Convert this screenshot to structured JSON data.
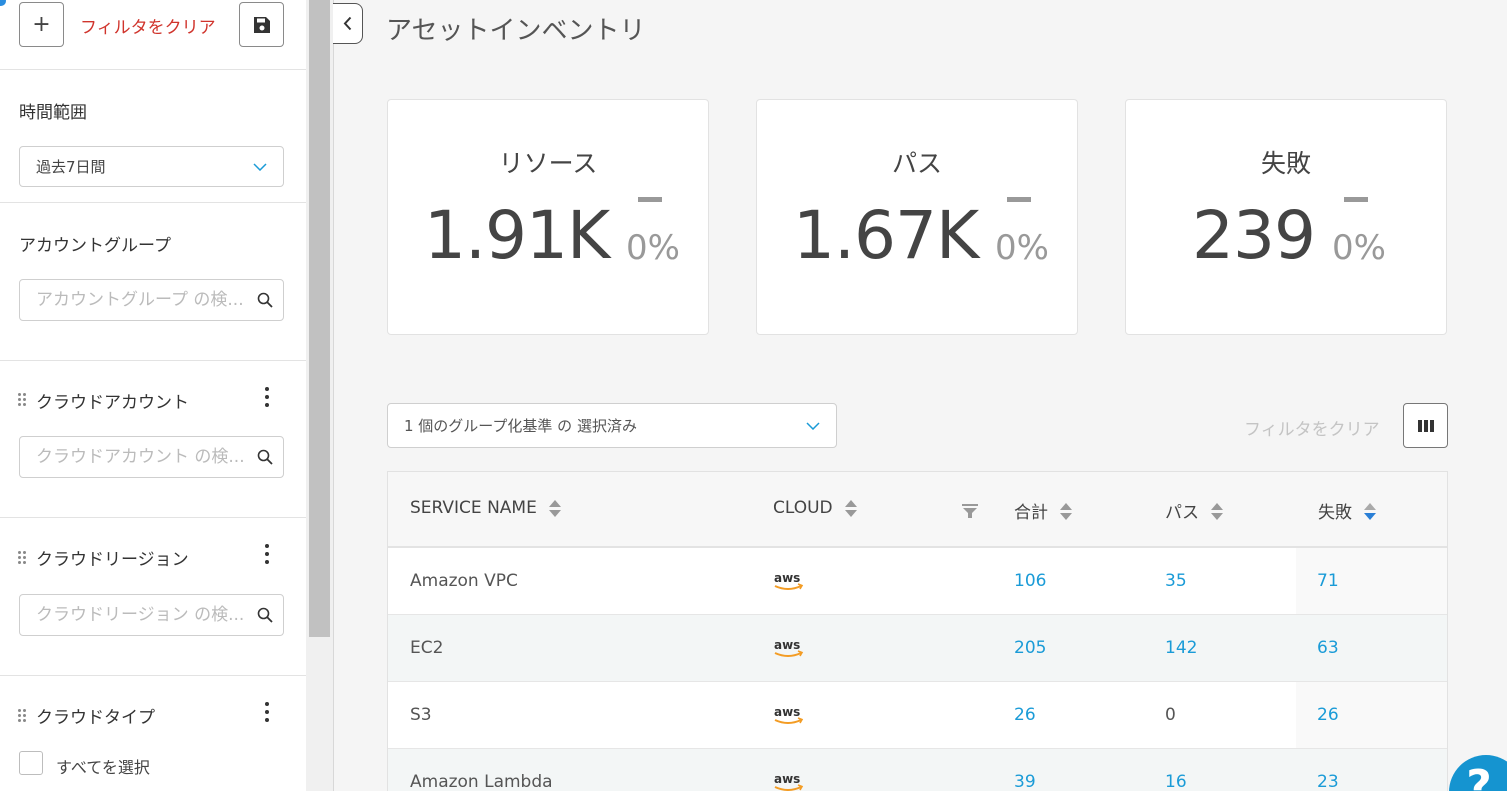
{
  "sidebar": {
    "clear_filters": "フィルタをクリア",
    "time_range": {
      "label": "時間範囲",
      "value": "過去7日間"
    },
    "account_group": {
      "label": "アカウントグループ",
      "placeholder": "アカウントグループ の検..."
    },
    "cloud_account": {
      "label": "クラウドアカウント",
      "placeholder": "クラウドアカウント の検..."
    },
    "cloud_region": {
      "label": "クラウドリージョン",
      "placeholder": "クラウドリージョン の検..."
    },
    "cloud_type": {
      "label": "クラウドタイプ",
      "select_all": "すべてを選択"
    }
  },
  "page": {
    "title": "アセットインベントリ"
  },
  "cards": [
    {
      "title": "リソース",
      "value": "1.91K",
      "change": "0%"
    },
    {
      "title": "パス",
      "value": "1.67K",
      "change": "0%"
    },
    {
      "title": "失敗",
      "value": "239",
      "change": "0%"
    }
  ],
  "toolbar": {
    "group_by": "1 個のグループ化基準 の 選択済み",
    "clear_filters": "フィルタをクリア"
  },
  "table": {
    "columns": [
      "SERVICE NAME",
      "CLOUD",
      "合計",
      "パス",
      "失敗"
    ],
    "rows": [
      {
        "service": "Amazon VPC",
        "cloud": "aws",
        "total": "106",
        "pass": "35",
        "fail": "71"
      },
      {
        "service": "EC2",
        "cloud": "aws",
        "total": "205",
        "pass": "142",
        "fail": "63"
      },
      {
        "service": "S3",
        "cloud": "aws",
        "total": "26",
        "pass": "0",
        "fail": "26"
      },
      {
        "service": "Amazon Lambda",
        "cloud": "aws",
        "total": "39",
        "pass": "16",
        "fail": "23"
      }
    ]
  },
  "help": {
    "label": "?"
  },
  "colors": {
    "accent": "#1a9bd7",
    "danger": "#d0342c",
    "aws_orange": "#f39c24"
  }
}
